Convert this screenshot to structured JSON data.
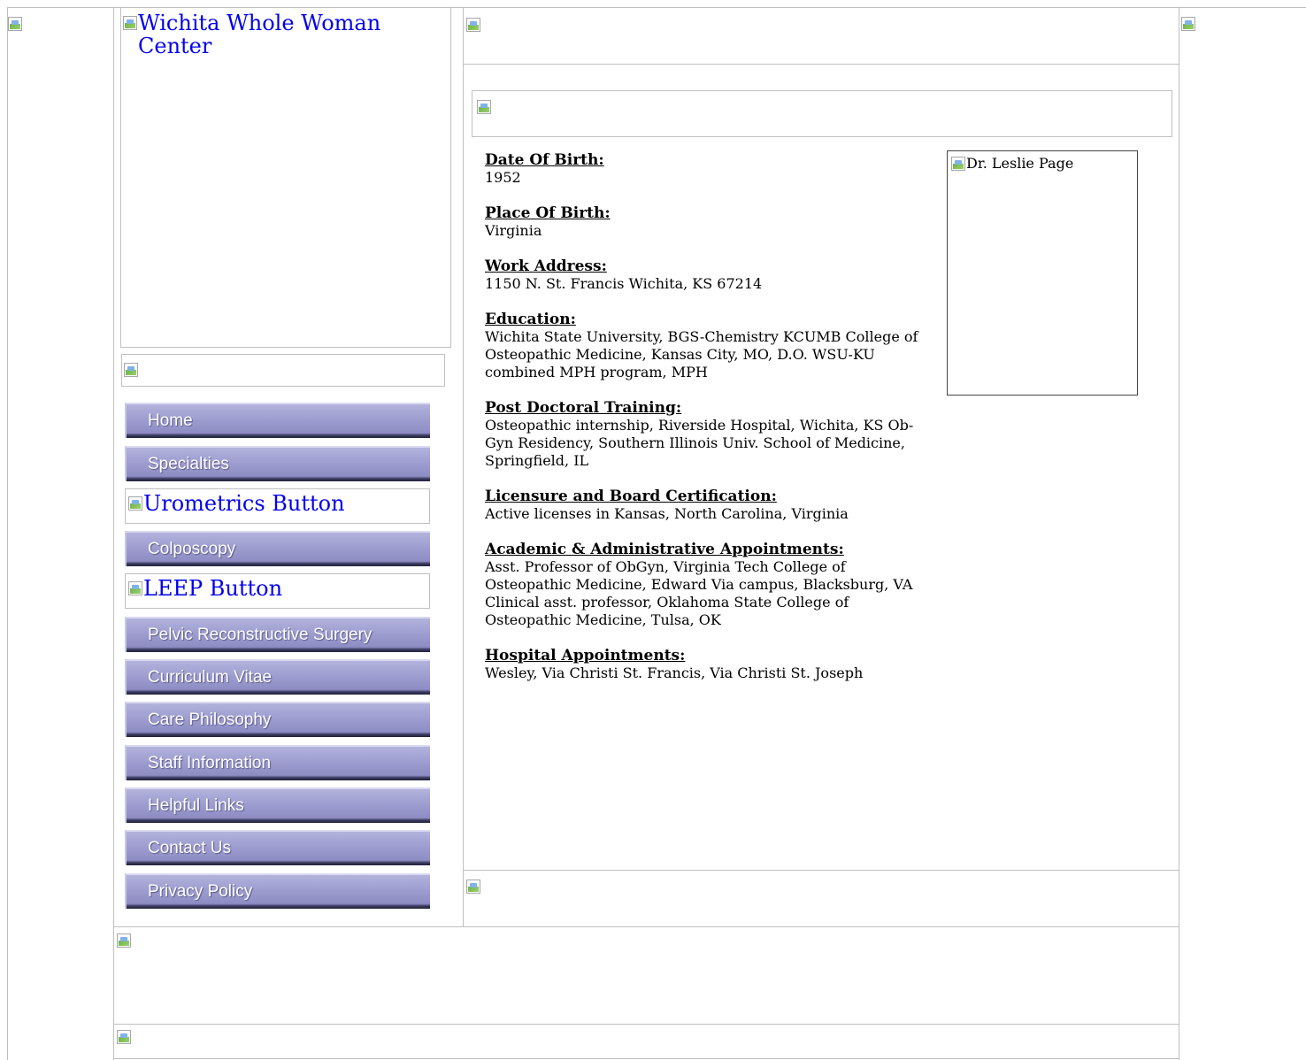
{
  "header": {
    "logo_alt": "Wichita Whole Woman Center"
  },
  "nav": {
    "items": [
      {
        "label": "Home",
        "type": "button"
      },
      {
        "label": "Specialties",
        "type": "button"
      },
      {
        "label": "Urometrics Button",
        "type": "alt"
      },
      {
        "label": "Colposcopy",
        "type": "button"
      },
      {
        "label": "LEEP Button",
        "type": "alt"
      },
      {
        "label": "Pelvic Reconstructive Surgery",
        "type": "button"
      },
      {
        "label": "Curriculum Vitae",
        "type": "button"
      },
      {
        "label": "Care Philosophy",
        "type": "button"
      },
      {
        "label": "Staff Information",
        "type": "button"
      },
      {
        "label": "Helpful Links",
        "type": "button"
      },
      {
        "label": "Contact Us",
        "type": "button"
      },
      {
        "label": "Privacy Policy",
        "type": "button"
      }
    ]
  },
  "profile": {
    "photo_alt": "Dr. Leslie Page",
    "sections": [
      {
        "label": "Date Of Birth:",
        "value": "1952"
      },
      {
        "label": "Place Of Birth:",
        "value": "Virginia"
      },
      {
        "label": "Work Address:",
        "value": "1150 N. St. Francis Wichita, KS 67214"
      },
      {
        "label": "Education:",
        "value": "Wichita State University, BGS-Chemistry KCUMB College of Osteopathic Medicine, Kansas City, MO, D.O. WSU-KU combined MPH program, MPH"
      },
      {
        "label": "Post Doctoral Training:",
        "value": "Osteopathic internship, Riverside Hospital, Wichita, KS Ob-Gyn Residency, Southern Illinois Univ. School of Medicine, Springfield, IL"
      },
      {
        "label": "Licensure and Board Certification:",
        "value": "Active licenses in Kansas, North Carolina, Virginia"
      },
      {
        "label": "Academic & Administrative Appointments:",
        "value": "Asst. Professor of ObGyn, Virginia Tech College of Osteopathic Medicine, Edward Via campus, Blacksburg, VA Clinical asst. professor, Oklahoma State College of Osteopathic Medicine, Tulsa, OK"
      },
      {
        "label": "Hospital Appointments:",
        "value": "Wesley, Via Christi St. Francis, Via Christi St. Joseph"
      }
    ]
  },
  "colors": {
    "nav_button": "#9d9dd0",
    "link": "#0000ee",
    "frame": "#c0c0c0"
  }
}
